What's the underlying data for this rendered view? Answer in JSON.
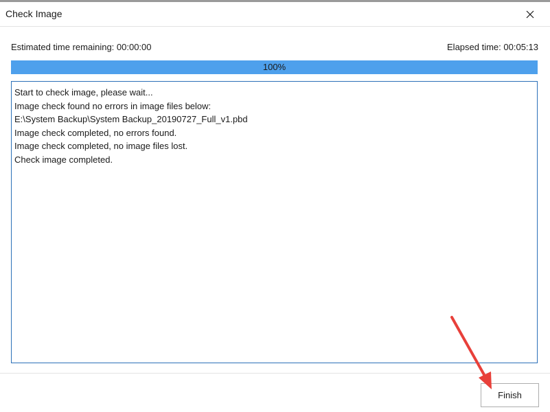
{
  "window": {
    "title": "Check Image",
    "close_icon": "close-icon"
  },
  "status": {
    "estimated_remaining": "Estimated time remaining: 00:00:00",
    "elapsed": "Elapsed time: 00:05:13"
  },
  "progress": {
    "value_percent": 100,
    "label": "100%",
    "fill_color": "#4ea0ec"
  },
  "log": {
    "lines": [
      "Start to check image, please wait...",
      "Image check found no errors in image files below:",
      "E:\\System Backup\\System Backup_20190727_Full_v1.pbd",
      "Image check completed, no errors found.",
      "Image check completed, no image files lost.",
      "Check image completed."
    ]
  },
  "buttons": {
    "finish_label": "Finish"
  },
  "annotation": {
    "arrow_color": "#e8403a",
    "points_to": "finish-button"
  }
}
